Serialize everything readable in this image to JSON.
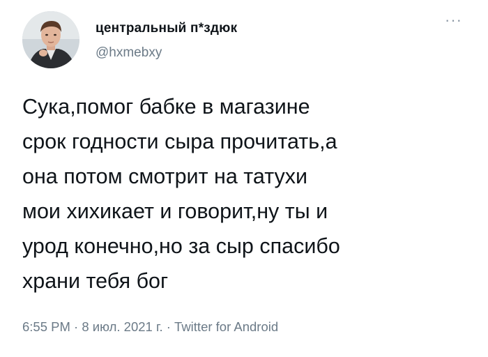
{
  "author": {
    "display_name": "центральный п*здюк",
    "handle": "@hxmebxy",
    "avatar_icon": "profile-photo"
  },
  "menu": {
    "more_icon": "more-horizontal-icon",
    "more_glyph": "···"
  },
  "tweet": {
    "lines": [
      "Сука,помог бабке в магазине",
      "срок годности сыра прочитать,а",
      "она потом смотрит на татухи",
      "мои хихикает и говорит,ну ты и",
      "урод конечно,но за сыр спасибо",
      "храни тебя бог"
    ]
  },
  "meta": {
    "time": "6:55 PM",
    "separator": " · ",
    "date": "8 июл. 2021 г.",
    "source": "Twitter for Android"
  },
  "colors": {
    "text": "#0f1419",
    "secondary": "#6b7a87",
    "background": "#ffffff"
  }
}
